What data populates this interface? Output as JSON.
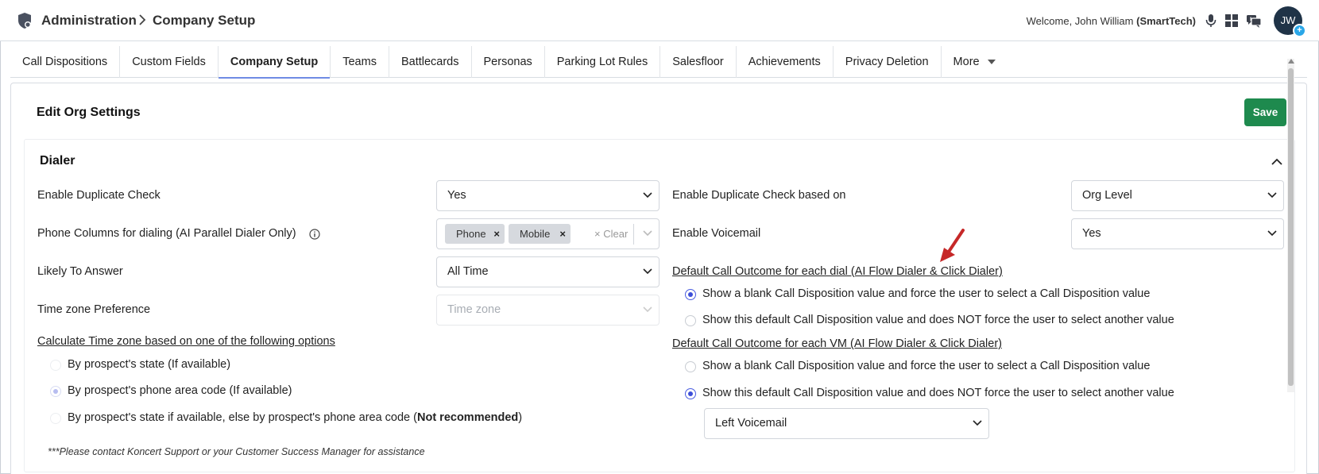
{
  "header": {
    "breadcrumb": [
      "Administration",
      "Company Setup"
    ],
    "welcome_prefix": "Welcome, John William ",
    "welcome_org": "(SmartTech)",
    "avatar_initials": "JW",
    "icons": [
      "microphone-icon",
      "apps-grid-icon",
      "chat-icon"
    ]
  },
  "tabs": [
    {
      "label": "Call Dispositions"
    },
    {
      "label": "Custom Fields"
    },
    {
      "label": "Company Setup",
      "active": true
    },
    {
      "label": "Teams"
    },
    {
      "label": "Battlecards"
    },
    {
      "label": "Personas"
    },
    {
      "label": "Parking Lot Rules"
    },
    {
      "label": "Salesfloor"
    },
    {
      "label": "Achievements"
    },
    {
      "label": "Privacy Deletion"
    },
    {
      "label": "More"
    }
  ],
  "card": {
    "title": "Edit Org Settings",
    "save_label": "Save"
  },
  "dialer": {
    "title": "Dialer",
    "left": {
      "dup_check_label": "Enable Duplicate Check",
      "dup_check_value": "Yes",
      "phone_cols_label": "Phone Columns for dialing (AI Parallel Dialer Only)",
      "phone_chips": [
        "Phone",
        "Mobile"
      ],
      "clear_label": "Clear",
      "likely_label": "Likely To Answer",
      "likely_value": "All Time",
      "tz_pref_label": "Time zone Preference",
      "tz_pref_placeholder": "Time zone",
      "tz_calc_label": "Calculate Time zone based on one of the following options",
      "tz_options": [
        {
          "label": "By prospect's state (If available)",
          "selected": false
        },
        {
          "label": "By prospect's phone area code (If available)",
          "selected": true
        },
        {
          "label_main": "By prospect's state if available, else by prospect's phone area code (",
          "label_bold": "Not recommended",
          "label_end": ")",
          "selected": false
        }
      ],
      "note": "***Please contact Koncert Support or your Customer Success Manager for assistance"
    },
    "right": {
      "dup_based_label": "Enable Duplicate Check based on",
      "dup_based_value": "Org Level",
      "voicemail_label": "Enable Voicemail",
      "voicemail_value": "Yes",
      "outcome_dial_label": "Default Call Outcome for each dial (AI Flow Dialer & Click Dialer)",
      "outcome_dial_options": [
        {
          "label": "Show a blank Call Disposition value and force the user to select a Call Disposition value",
          "selected": true
        },
        {
          "label": "Show this default Call Disposition value and does NOT force the user to select another value",
          "selected": false
        }
      ],
      "outcome_vm_label": "Default Call Outcome for each VM (AI Flow Dialer & Click Dialer)",
      "outcome_vm_options": [
        {
          "label": "Show a blank Call Disposition value and force the user to select a Call Disposition value",
          "selected": false
        },
        {
          "label": "Show this default Call Disposition value and does NOT force the user to select another value",
          "selected": true
        }
      ],
      "vm_disposition_value": "Left Voicemail"
    }
  },
  "colors": {
    "save_green": "#1e8a4e",
    "radio_blue": "#3d4fd8",
    "annotation_red": "#c62828",
    "avatar_bg": "#1f3347"
  }
}
